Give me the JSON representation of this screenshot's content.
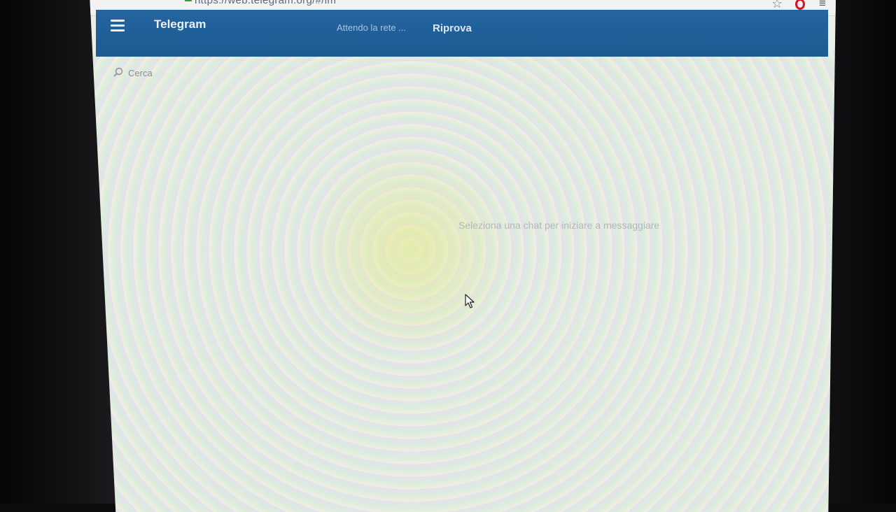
{
  "browser": {
    "url": "https://web.telegram.org/#/im",
    "icons": [
      "star-icon",
      "opera-icon",
      "menu-icon"
    ]
  },
  "header": {
    "title": "Telegram",
    "status": "Attendo la rete ...",
    "retry_label": "Riprova",
    "accent_color": "#1f5f98"
  },
  "search": {
    "placeholder": "Cerca"
  },
  "main": {
    "empty_message": "Seleziona una chat per iniziare a messaggiare"
  }
}
